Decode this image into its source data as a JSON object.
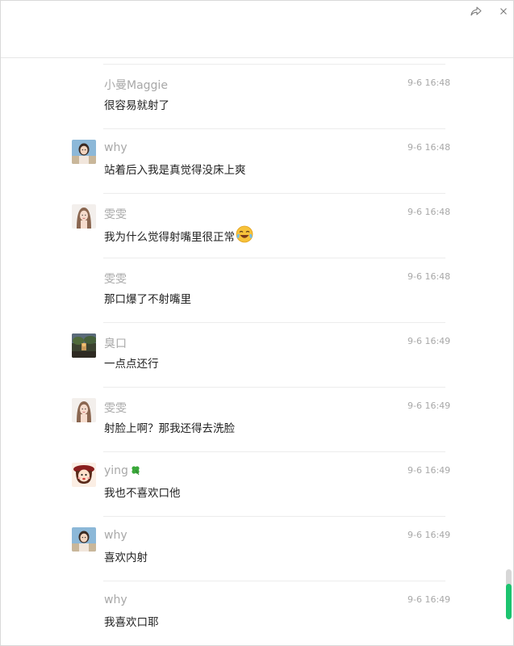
{
  "titlebar": {
    "share_icon": "share-arrow-icon",
    "close_icon": "close-icon"
  },
  "messages": [
    {
      "sender": "小曼Maggie",
      "time": "9-6 16:48",
      "text": "很容易就射了",
      "avatar": null
    },
    {
      "sender": "why",
      "time": "9-6 16:48",
      "text": "站着后入我是真觉得没床上爽",
      "avatar": "girl-photo"
    },
    {
      "sender": "雯雯",
      "time": "9-6 16:48",
      "text": "我为什么觉得射嘴里很正常",
      "avatar": "woman-portrait",
      "emoji": "laughing-crying-emoji"
    },
    {
      "sender": "雯雯",
      "time": "9-6 16:48",
      "text": "那口爆了不射嘴里",
      "avatar": null
    },
    {
      "sender": "臭口",
      "time": "9-6 16:49",
      "text": "一点点还行",
      "avatar": "night-scene"
    },
    {
      "sender": "雯雯",
      "time": "9-6 16:49",
      "text": "射脸上啊？那我还得去洗脸",
      "avatar": "woman-portrait"
    },
    {
      "sender": "ying",
      "time": "9-6 16:49",
      "text": "我也不喜欢口他",
      "avatar": "cartoon-girl",
      "badge": "four-leaf-clover-icon"
    },
    {
      "sender": "why",
      "time": "9-6 16:49",
      "text": "喜欢内射",
      "avatar": "girl-photo"
    },
    {
      "sender": "why",
      "time": "9-6 16:49",
      "text": "我喜欢口耶",
      "avatar": null
    }
  ],
  "colors": {
    "name": "#a8a8a8",
    "text": "#1f1f1f",
    "divider": "#ececec",
    "scroll_accent": "#1bc46f"
  }
}
